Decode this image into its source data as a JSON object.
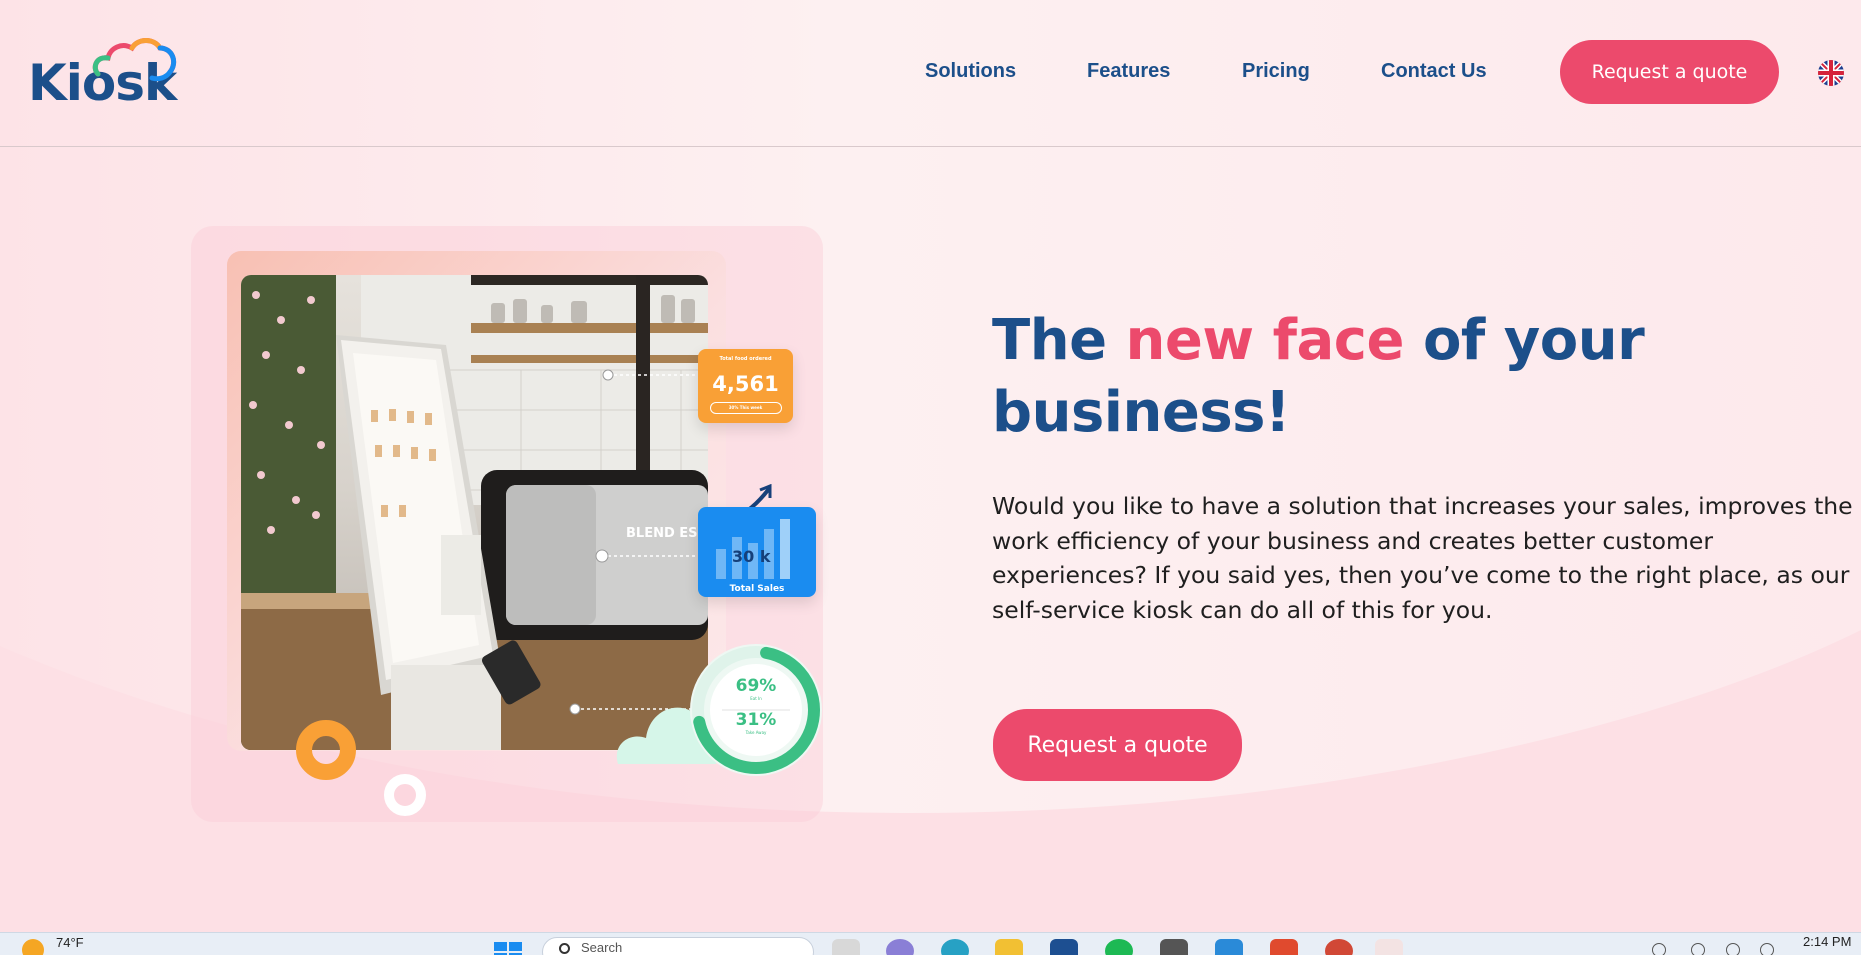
{
  "brand": {
    "name": "Kiosk"
  },
  "nav": {
    "items": [
      "Solutions",
      "Features",
      "Pricing",
      "Contact Us"
    ],
    "cta": "Request a quote",
    "language_icon": "uk-flag-icon"
  },
  "hero": {
    "title_part1": "The ",
    "title_accent": "new face",
    "title_part2": " of your business!",
    "description": "Would you like to have a solution that increases your sales, improves the work efficiency of your business and creates better customer experiences? If you said yes, then you’ve come to the right place, as our self-service kiosk can do all of this for you.",
    "cta": "Request a quote"
  },
  "stats": {
    "total_food_label": "Total food ordered",
    "total_food_value": "4,561",
    "total_food_sub": "30% This week",
    "sales_value": "30 k",
    "sales_label": "Total Sales",
    "eat_in_pct": "69%",
    "eat_in_label": "Eat In",
    "take_away_pct": "31%",
    "take_away_label": "Take Away",
    "espresso_label": "BLEND ESPRESSO"
  },
  "taskbar": {
    "temperature": "74°F",
    "search_placeholder": "Search",
    "time": "2:14 PM"
  },
  "colors": {
    "brand_blue": "#1c4f8a",
    "accent_pink": "#ec4a6c",
    "orange": "#f9a036",
    "blue_card": "#1a8cf0",
    "green": "#3bbf84"
  }
}
